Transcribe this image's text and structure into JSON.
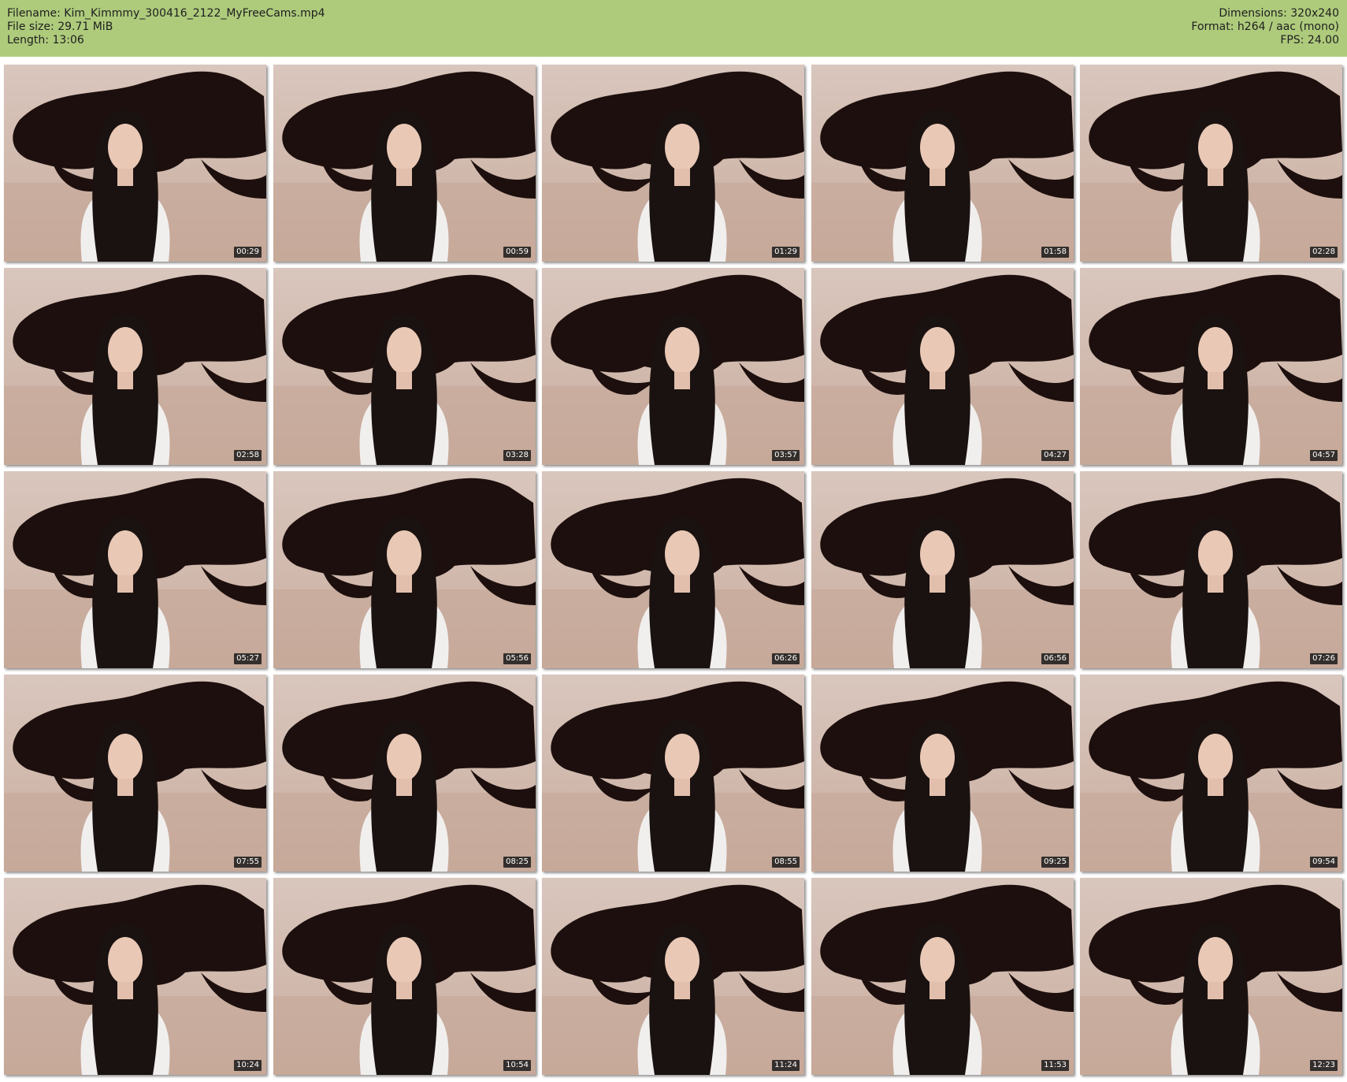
{
  "header": {
    "filename": "Filename: Kim_Kimmmy_300416_2122_MyFreeCams.mp4",
    "file_size": "File size: 29.71 MiB",
    "length": "Length: 13:06",
    "dimensions": "Dimensions: 320x240",
    "format": "Format: h264 / aac (mono)",
    "fps": "FPS: 24.00"
  },
  "colors": {
    "header_bg": "#aecb7c",
    "timestamp_bg": "#141414"
  },
  "thumbnails": [
    {
      "timestamp": "00:29"
    },
    {
      "timestamp": "00:59"
    },
    {
      "timestamp": "01:29"
    },
    {
      "timestamp": "01:58"
    },
    {
      "timestamp": "02:28"
    },
    {
      "timestamp": "02:58"
    },
    {
      "timestamp": "03:28"
    },
    {
      "timestamp": "03:57"
    },
    {
      "timestamp": "04:27"
    },
    {
      "timestamp": "04:57"
    },
    {
      "timestamp": "05:27"
    },
    {
      "timestamp": "05:56"
    },
    {
      "timestamp": "06:26"
    },
    {
      "timestamp": "06:56"
    },
    {
      "timestamp": "07:26"
    },
    {
      "timestamp": "07:55"
    },
    {
      "timestamp": "08:25"
    },
    {
      "timestamp": "08:55"
    },
    {
      "timestamp": "09:25"
    },
    {
      "timestamp": "09:54"
    },
    {
      "timestamp": "10:24"
    },
    {
      "timestamp": "10:54"
    },
    {
      "timestamp": "11:24"
    },
    {
      "timestamp": "11:53"
    },
    {
      "timestamp": "12:23"
    }
  ]
}
